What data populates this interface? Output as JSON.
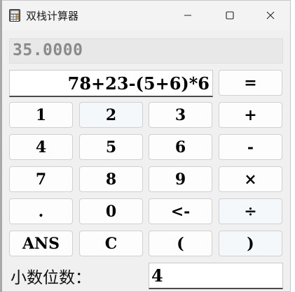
{
  "window": {
    "title": "双栈计算器"
  },
  "result": {
    "value": "35.0000"
  },
  "expression": {
    "value": "78+23-(5+6)*6"
  },
  "buttons": {
    "equals": "=",
    "one": "1",
    "two": "2",
    "three": "3",
    "plus": "+",
    "four": "4",
    "five": "5",
    "six": "6",
    "minus": "-",
    "seven": "7",
    "eight": "8",
    "nine": "9",
    "multiply": "×",
    "dot": ".",
    "zero": "0",
    "backspace": "<-",
    "divide": "÷",
    "ans": "ANS",
    "clear": "C",
    "lparen": "(",
    "rparen": ")"
  },
  "decimal_places": {
    "label": "小数位数：",
    "value": "4"
  },
  "icons": {
    "app": "calculator-icon",
    "minimize": "minimize-icon",
    "maximize": "maximize-icon",
    "close": "close-icon"
  }
}
